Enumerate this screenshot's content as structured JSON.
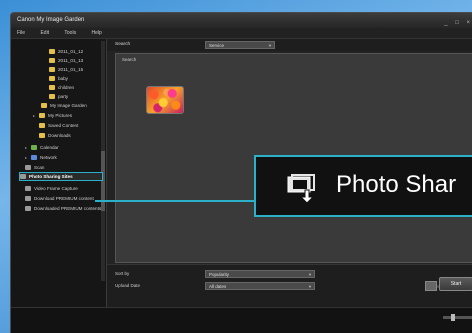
{
  "window": {
    "title": "Canon My Image Garden",
    "controls": "_ □ ×"
  },
  "menu": {
    "items": [
      "File",
      "Edit",
      "Tools",
      "Help"
    ]
  },
  "sidebar": {
    "tree": [
      {
        "label": "2011_01_12",
        "color": "yellow"
      },
      {
        "label": "2011_01_13",
        "color": "yellow"
      },
      {
        "label": "2011_01_15",
        "color": "yellow"
      },
      {
        "label": "baby",
        "color": "yellow"
      },
      {
        "label": "children",
        "color": "yellow"
      },
      {
        "label": "party",
        "color": "yellow"
      },
      {
        "label": "My Image Garden",
        "color": "yellow"
      },
      {
        "label": "My Pictures",
        "color": "yellow"
      },
      {
        "label": "Saved Content",
        "color": "yellow"
      },
      {
        "label": "Downloads",
        "color": "yellow"
      },
      {
        "label": "Calendar",
        "color": "green"
      },
      {
        "label": "Network",
        "color": "blue"
      },
      {
        "label": "Scan",
        "color": "grey"
      },
      {
        "label": "Photo Sharing Sites",
        "color": "grey"
      },
      {
        "label": "Video Frame Capture",
        "color": "grey"
      },
      {
        "label": "Download PREMIUM content",
        "color": "grey"
      },
      {
        "label": "Downloaded PREMIUM contents",
        "color": "grey"
      }
    ]
  },
  "main": {
    "sort_label": "Search",
    "sort_value": "Service",
    "panel_label": "Search",
    "sort_by_label": "Sort by",
    "sort_by_value": "Popularity",
    "upload_date_label": "Upload Date",
    "upload_date_value": "All dates",
    "start_button": "Start"
  },
  "callout": {
    "text": "Photo Shar"
  }
}
